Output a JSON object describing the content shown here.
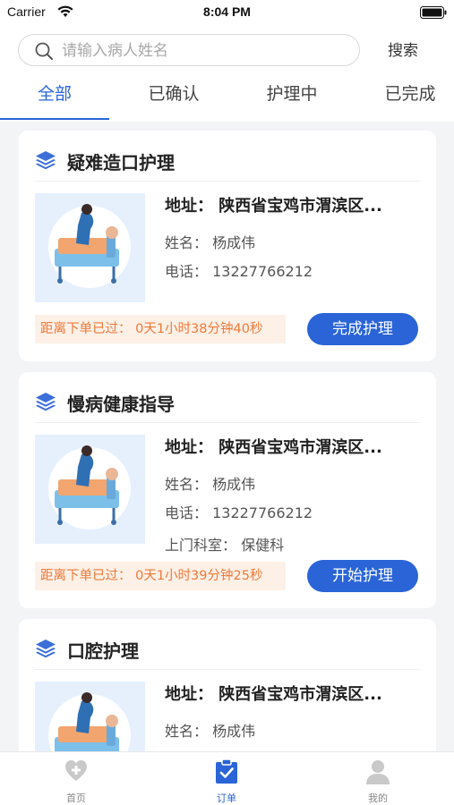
{
  "status_bar": {
    "carrier": "Carrier",
    "time": "8:04 PM"
  },
  "search": {
    "placeholder": "请输入病人姓名",
    "value": "",
    "button_label": "搜索"
  },
  "tabs": [
    {
      "label": "全部",
      "active": true
    },
    {
      "label": "已确认",
      "active": false
    },
    {
      "label": "护理中",
      "active": false
    },
    {
      "label": "已完成",
      "active": false
    }
  ],
  "orders": [
    {
      "title": "疑难造口护理",
      "address": "地址：  陕西省宝鸡市渭滨区...",
      "name": "姓名：  杨成伟",
      "phone": "电话：  13227766212",
      "department": "",
      "timer": "距离下单已过：  0天1小时38分钟40秒",
      "action_label": "完成护理"
    },
    {
      "title": "慢病健康指导",
      "address": "地址：  陕西省宝鸡市渭滨区...",
      "name": "姓名：  杨成伟",
      "phone": "电话：  13227766212",
      "department": "上门科室：  保健科",
      "timer": "距离下单已过：  0天1小时39分钟25秒",
      "action_label": "开始护理"
    },
    {
      "title": "口腔护理",
      "address": "地址：  陕西省宝鸡市渭滨区...",
      "name": "姓名：  杨成伟",
      "phone": "",
      "department": "",
      "timer": "",
      "action_label": ""
    }
  ],
  "bottom_nav": [
    {
      "label": "首页",
      "icon": "heart-plus-icon",
      "active": false
    },
    {
      "label": "订单",
      "icon": "clipboard-check-icon",
      "active": true
    },
    {
      "label": "我的",
      "icon": "user-icon",
      "active": false
    }
  ],
  "colors": {
    "accent": "#2a64d7",
    "timer_text": "#ee7a3a",
    "timer_bg": "#fdf0e6",
    "thumb_bg": "#e6f0fd"
  }
}
